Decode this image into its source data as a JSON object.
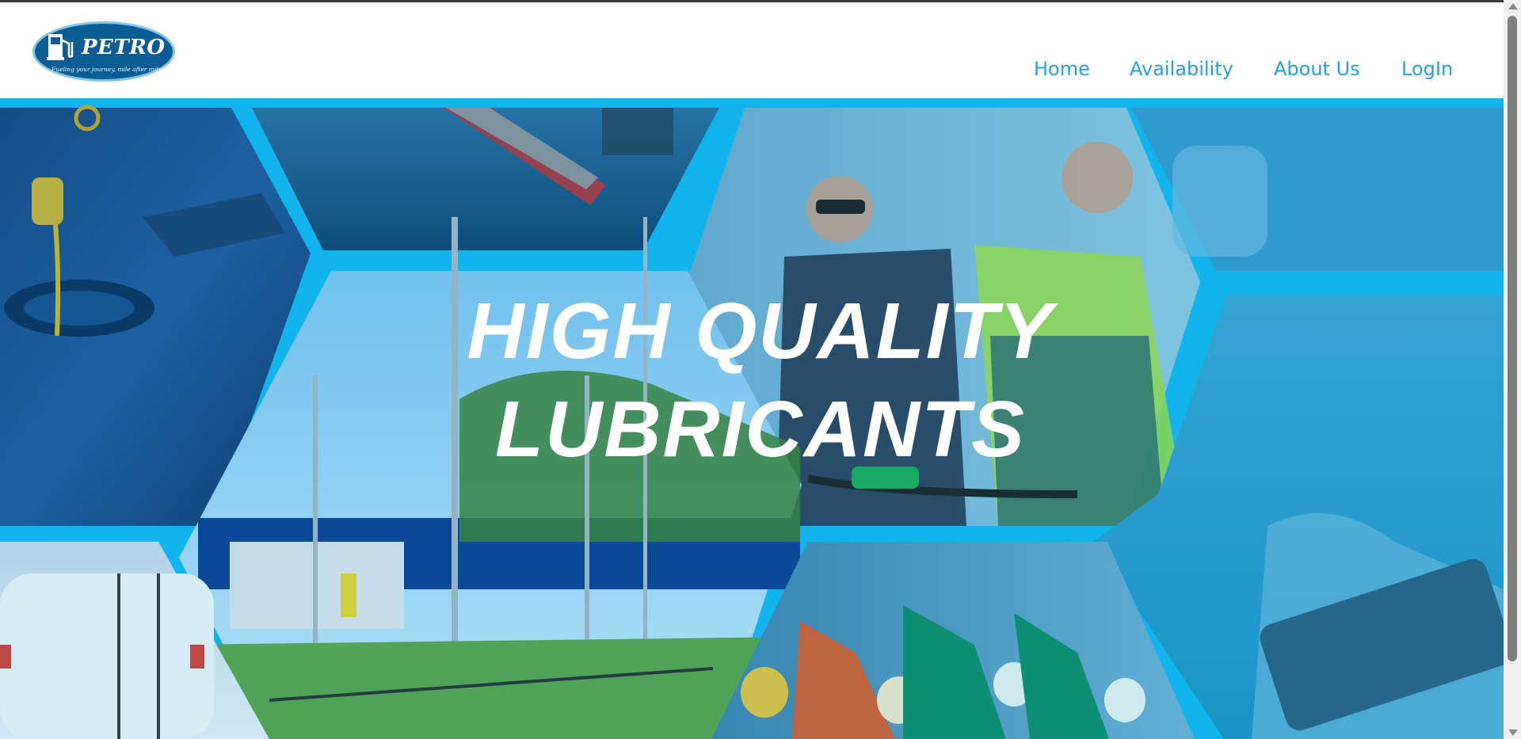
{
  "brand": {
    "name": "PETRO",
    "tagline": "Fueling your journey, mile after mile"
  },
  "nav": {
    "items": [
      {
        "label": "Home"
      },
      {
        "label": "Availability"
      },
      {
        "label": "About Us"
      },
      {
        "label": "LogIn"
      }
    ]
  },
  "hero": {
    "headline_line1": "HIGH QUALITY",
    "headline_line2": "LUBRICANTS"
  },
  "colors": {
    "brand_blue": "#0c5d94",
    "accent_cyan": "#13b6ee",
    "nav_link": "#23a1d9",
    "headline": "#ffffff"
  },
  "icons": {
    "logo": "fuel-pump-icon",
    "scroll_up": "chevron-up-icon",
    "scroll_down": "chevron-down-icon"
  }
}
